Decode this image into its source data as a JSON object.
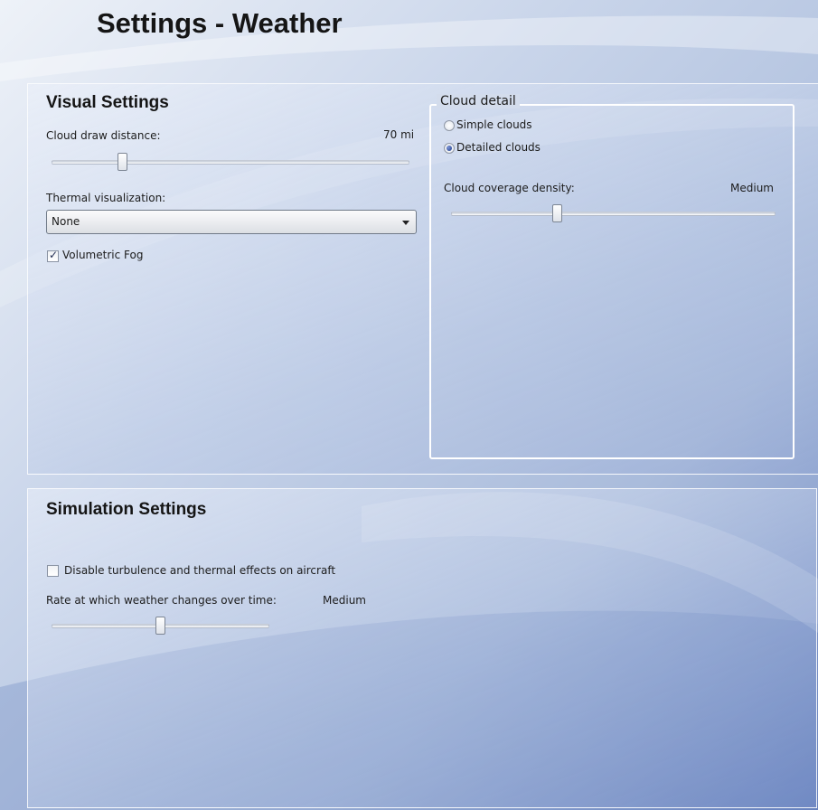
{
  "header": {
    "title": "Settings - Weather"
  },
  "visual": {
    "title": "Visual Settings",
    "cloud_draw_distance": {
      "label": "Cloud draw distance:",
      "value": "70 mi",
      "level": 0.2
    },
    "thermal": {
      "label": "Thermal visualization:",
      "selected": "None"
    },
    "volumetric_fog": {
      "label": "Volumetric Fog",
      "checked": true
    }
  },
  "cloud_detail": {
    "legend": "Cloud detail",
    "options": [
      {
        "label": "Simple clouds",
        "selected": false
      },
      {
        "label": "Detailed clouds",
        "selected": true
      }
    ],
    "coverage": {
      "label": "Cloud coverage density:",
      "value": "Medium",
      "level": 0.33
    }
  },
  "simulation": {
    "title": "Simulation Settings",
    "disable_turbulence": {
      "label": "Disable turbulence and thermal effects on aircraft",
      "checked": false
    },
    "weather_rate": {
      "label": "Rate at which weather changes over time:",
      "value": "Medium",
      "level": 0.5
    }
  },
  "colors": {
    "accent": "#1c3b8a",
    "panel_border": "#ffffff"
  }
}
